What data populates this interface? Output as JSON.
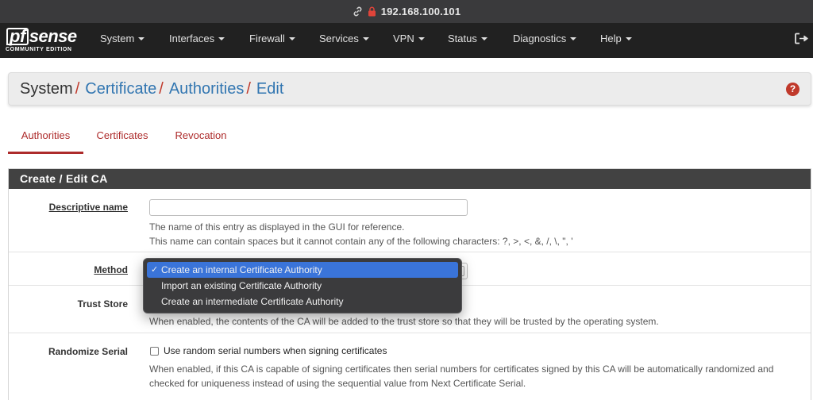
{
  "browser": {
    "url": "192.168.100.101"
  },
  "brand": {
    "logo_pf": "pf",
    "logo_rest": "sense",
    "edition": "COMMUNITY EDITION"
  },
  "nav": {
    "items": [
      {
        "label": "System"
      },
      {
        "label": "Interfaces"
      },
      {
        "label": "Firewall"
      },
      {
        "label": "Services"
      },
      {
        "label": "VPN"
      },
      {
        "label": "Status"
      },
      {
        "label": "Diagnostics"
      },
      {
        "label": "Help"
      }
    ]
  },
  "breadcrumb": {
    "root": "System",
    "level1": "Certificate",
    "level2": "Authorities",
    "level3": "Edit",
    "separator": "/"
  },
  "tabs": [
    {
      "label": "Authorities",
      "active": true
    },
    {
      "label": "Certificates",
      "active": false
    },
    {
      "label": "Revocation",
      "active": false
    }
  ],
  "panel": {
    "title": "Create / Edit CA",
    "descriptive_name": {
      "label": "Descriptive name",
      "value": "",
      "help1": "The name of this entry as displayed in the GUI for reference.",
      "help2": "This name can contain spaces but it cannot contain any of the following characters: ?, >, <, &, /, \\, \", '"
    },
    "method": {
      "label": "Method",
      "options": [
        "Create an internal Certificate Authority",
        "Import an existing Certificate Authority",
        "Create an intermediate Certificate Authority"
      ],
      "selected_index": 0
    },
    "trust_store": {
      "label": "Trust Store",
      "help": "When enabled, the contents of the CA will be added to the trust store so that they will be trusted by the operating system."
    },
    "randomize_serial": {
      "label": "Randomize Serial",
      "checkbox_label": "Use random serial numbers when signing certificates",
      "help1": "When enabled, if this CA is capable of signing certificates then serial numbers for certificates signed by this CA will be automatically randomized and",
      "help2": "checked for uniqueness instead of using the sequential value from Next Certificate Serial."
    }
  },
  "colors": {
    "accent_red": "#ad2b2b",
    "link_blue": "#3276b1",
    "navbar": "#212121",
    "panel_head": "#424242",
    "dropdown_selected": "#3a74d9"
  }
}
